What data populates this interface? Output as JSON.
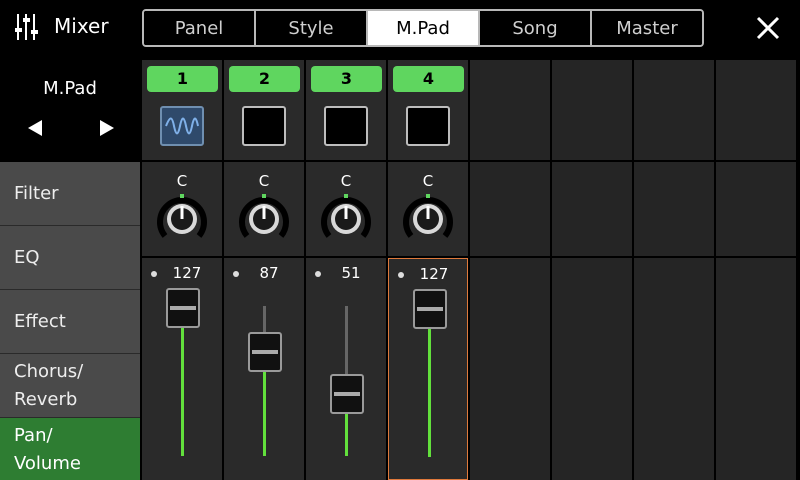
{
  "header": {
    "title": "Mixer",
    "tabs": [
      {
        "label": "Panel"
      },
      {
        "label": "Style"
      },
      {
        "label": "M.Pad",
        "active": true
      },
      {
        "label": "Song"
      },
      {
        "label": "Master"
      }
    ]
  },
  "part_selector": {
    "name": "M.Pad"
  },
  "menu": {
    "items": [
      {
        "label": "Filter"
      },
      {
        "label": "EQ"
      },
      {
        "label": "Effect"
      },
      {
        "label": "Chorus/\nReverb"
      },
      {
        "label": "Pan/\nVolume",
        "active": true
      }
    ]
  },
  "channels": [
    {
      "number": "1",
      "pad_icon": "wave-icon",
      "pan": "C",
      "volume": "127"
    },
    {
      "number": "2",
      "pad_icon": "",
      "pan": "C",
      "volume": "87"
    },
    {
      "number": "3",
      "pad_icon": "",
      "pan": "C",
      "volume": "51"
    },
    {
      "number": "4",
      "pad_icon": "",
      "pan": "C",
      "volume": "127"
    }
  ],
  "colors": {
    "accent_green": "#5fd65f",
    "active_menu": "#2e7d32",
    "fader_fill": "#62e03c",
    "selected_border": "#e07a3c"
  }
}
